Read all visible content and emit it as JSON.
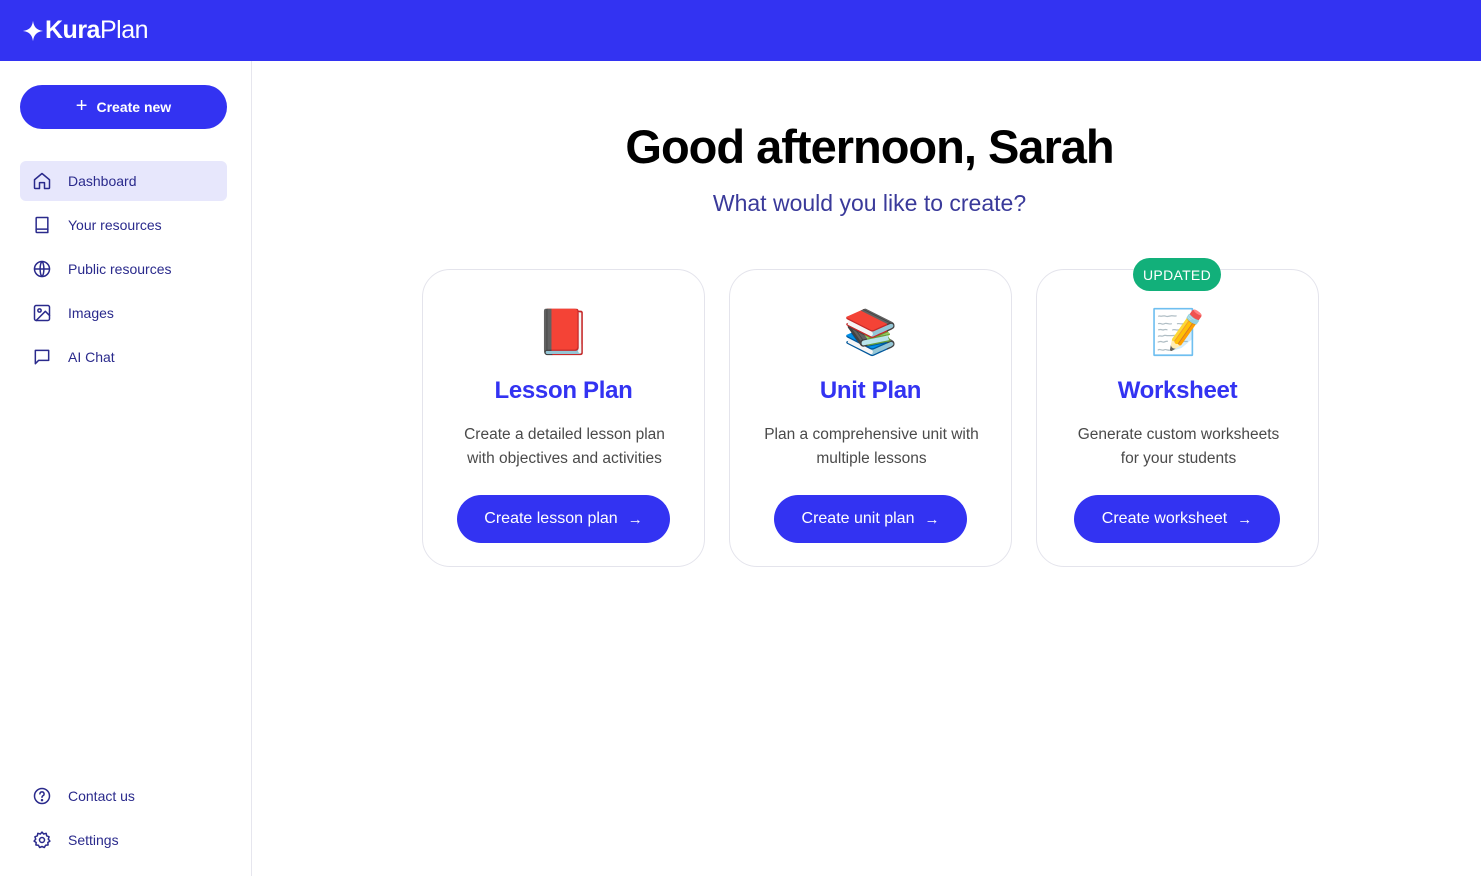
{
  "brand": {
    "name_bold": "Kura",
    "name_light": "Plan",
    "bar_color": "#3333f2"
  },
  "sidebar": {
    "create_label": "Create new",
    "items": [
      {
        "label": "Dashboard",
        "icon": "home-icon",
        "active": true
      },
      {
        "label": "Your resources",
        "icon": "book-icon"
      },
      {
        "label": "Public resources",
        "icon": "globe-icon"
      },
      {
        "label": "Images",
        "icon": "image-icon"
      },
      {
        "label": "AI Chat",
        "icon": "chat-icon"
      }
    ],
    "bottom_items": [
      {
        "label": "Contact us",
        "icon": "help-circle-icon"
      },
      {
        "label": "Settings",
        "icon": "gear-icon"
      }
    ]
  },
  "main": {
    "greeting": "Good afternoon, Sarah",
    "subtitle": "What would you like to create?",
    "cards": [
      {
        "emoji": "📕",
        "title": "Lesson Plan",
        "desc_line1": "Create a detailed lesson plan",
        "desc_line2": "with objectives and activities",
        "button": "Create lesson plan",
        "arrow": "→"
      },
      {
        "emoji": "📚",
        "title": "Unit Plan",
        "desc_line1": "Plan a comprehensive unit with",
        "desc_line2": "multiple lessons",
        "button": "Create unit plan",
        "arrow": "→"
      },
      {
        "emoji": "📝",
        "title": "Worksheet",
        "desc_line1": "Generate custom worksheets",
        "desc_line2": "for your students",
        "button": "Create worksheet",
        "arrow": "→",
        "badge": "UPDATED"
      }
    ]
  },
  "colors": {
    "accent": "#3333f2",
    "badge": "#12b07a",
    "nav_active_bg": "#e7e7fc",
    "nav_text": "#2a2a8c"
  }
}
